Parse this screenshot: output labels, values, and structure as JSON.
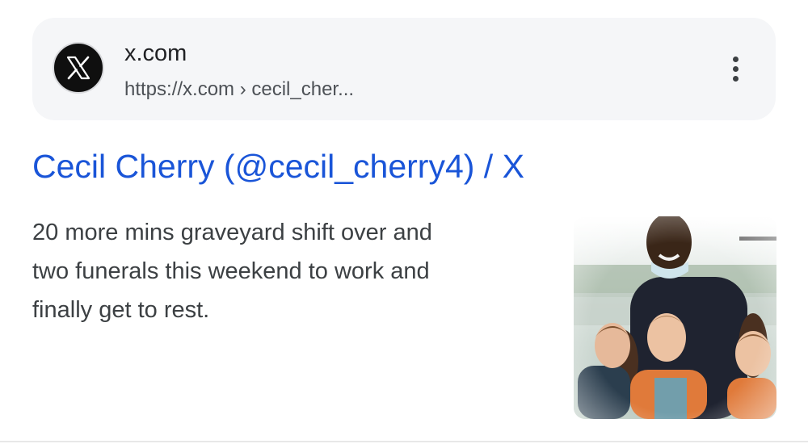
{
  "result": {
    "site_name": "x.com",
    "url": "https://x.com › cecil_cher...",
    "title": "Cecil Cherry (@cecil_cherry4) / X",
    "snippet_lines": [
      "20 more mins graveyard shift over and",
      "two funerals this weekend to work and",
      "finally get to rest."
    ],
    "favicon_icon": "x-logo-icon",
    "more_icon": "more-vert-icon",
    "thumbnail_alt": "photo-thumbnail"
  },
  "colors": {
    "title_link": "#1a55d8",
    "source_bar_bg": "#f5f6f8",
    "text_primary": "#202124",
    "text_secondary": "#4d5156"
  }
}
